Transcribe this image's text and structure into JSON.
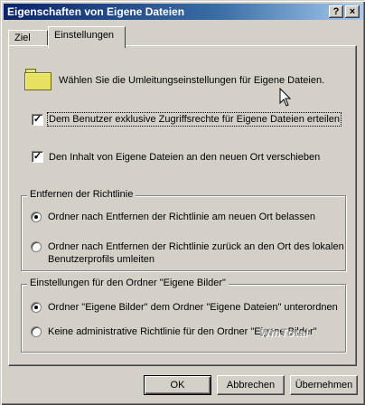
{
  "window": {
    "title": "Eigenschaften von Eigene Dateien",
    "help_label": "?",
    "close_label": "×"
  },
  "tabs": [
    {
      "label": "Ziel",
      "active": false
    },
    {
      "label": "Einstellungen",
      "active": true
    }
  ],
  "panel": {
    "intro_text": "Wählen Sie die Umleitungseinstellungen für Eigene Dateien.",
    "check_exclusive": {
      "label": "Dem Benutzer exklusive Zugriffsrechte für Eigene Dateien erteilen",
      "checked": true,
      "mark": "✓"
    },
    "check_move": {
      "label": "Den Inhalt von Eigene Dateien an den neuen Ort verschieben",
      "checked": true,
      "mark": "✓"
    },
    "group_removal": {
      "title": "Entfernen der Richtlinie",
      "options": [
        {
          "label": "Ordner nach Entfernen der Richtlinie am neuen Ort belassen",
          "selected": true
        },
        {
          "label_line1": "Ordner nach Entfernen der Richtlinie zurück an den Ort des lokalen",
          "label_line2": "Benutzerprofils umleiten",
          "selected": false
        }
      ]
    },
    "group_pictures": {
      "title": "Einstellungen für den Ordner \"Eigene Bilder\"",
      "options": [
        {
          "label": "Ordner \"Eigene Bilder\" dem Ordner \"Eigene Dateien\" unterordnen",
          "selected": true
        },
        {
          "label": "Keine administrative Richtlinie für den Ordner \"Eigene Bilder\"",
          "selected": false
        }
      ]
    }
  },
  "watermark": "WinTotal",
  "buttons": {
    "ok": "OK",
    "cancel": "Abbrechen",
    "apply": "Übernehmen"
  }
}
